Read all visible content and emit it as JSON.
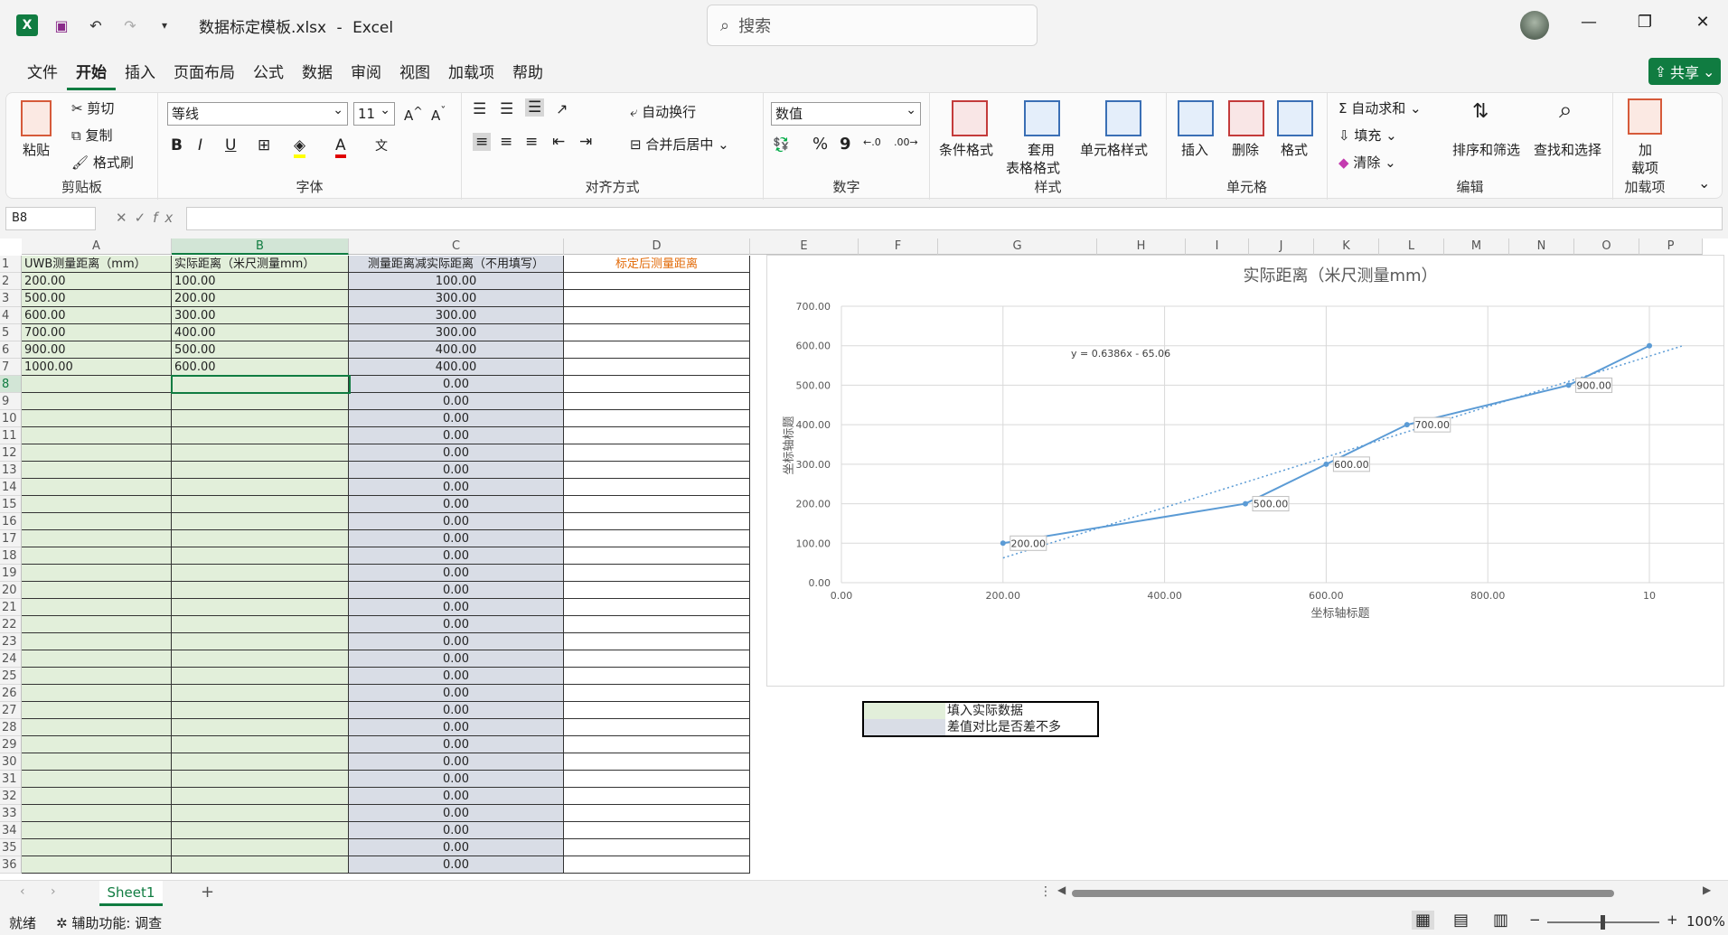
{
  "titlebar": {
    "filename": "数据标定模板.xlsx",
    "sep": "-",
    "app": "Excel",
    "search_placeholder": "搜索"
  },
  "menu": {
    "tabs": [
      "文件",
      "开始",
      "插入",
      "页面布局",
      "公式",
      "数据",
      "审阅",
      "视图",
      "加载项",
      "帮助"
    ],
    "active": "开始",
    "share": "共享"
  },
  "ribbon": {
    "clipboard": {
      "paste": "粘贴",
      "cut": "剪切",
      "copy": "复制",
      "format_painter": "格式刷",
      "label": "剪贴板"
    },
    "font": {
      "name": "等线",
      "size": "11",
      "label": "字体",
      "bold": "B",
      "italic": "I",
      "underline": "U"
    },
    "align": {
      "wrap": "自动换行",
      "merge": "合并后居中",
      "label": "对齐方式"
    },
    "number": {
      "format": "数值",
      "label": "数字",
      "percent": "%",
      "comma": "9"
    },
    "styles": {
      "cond": "条件格式",
      "table1": "套用",
      "table2": "表格格式",
      "cell": "单元格样式",
      "label": "样式"
    },
    "cells": {
      "insert": "插入",
      "delete": "删除",
      "format": "格式",
      "label": "单元格"
    },
    "edit": {
      "autosum": "自动求和",
      "fill": "填充",
      "clear": "清除",
      "sort": "排序和筛选",
      "find": "查找和选择",
      "label": "编辑"
    },
    "addins": {
      "l1": "加",
      "l2": "载项",
      "label": "加载项"
    }
  },
  "formula_bar": {
    "name_box": "B8",
    "fx": "fx",
    "value": ""
  },
  "columns": [
    "A",
    "B",
    "C",
    "D",
    "E",
    "F",
    "G",
    "H",
    "I",
    "J",
    "K",
    "L",
    "M",
    "N",
    "O",
    "P"
  ],
  "selected_column": "B",
  "selected_row": 8,
  "headers": {
    "A": "UWB测量距离（mm）",
    "B": "实际距离（米尺测量mm）",
    "C": "测量距离减实际距离（不用填写）",
    "D": "标定后测量距离"
  },
  "rows": [
    {
      "a": "200.00",
      "b": "100.00",
      "c": "100.00"
    },
    {
      "a": "500.00",
      "b": "200.00",
      "c": "300.00"
    },
    {
      "a": "600.00",
      "b": "300.00",
      "c": "300.00"
    },
    {
      "a": "700.00",
      "b": "400.00",
      "c": "300.00"
    },
    {
      "a": "900.00",
      "b": "500.00",
      "c": "400.00"
    },
    {
      "a": "1000.00",
      "b": "600.00",
      "c": "400.00"
    }
  ],
  "empty_c": "0.00",
  "legend": {
    "fill": "填入实际数据",
    "diff": "差值对比是否差不多",
    "fill_color": "#e2efda",
    "diff_color": "#d9dde6"
  },
  "chart_data": {
    "type": "scatter",
    "title": "实际距离（米尺测量mm）",
    "xlabel": "坐标轴标题",
    "ylabel": "坐标轴标题",
    "trendline": "y = 0.6386x - 65.06",
    "x": [
      200,
      500,
      600,
      700,
      900,
      1000
    ],
    "y": [
      100,
      200,
      300,
      400,
      500,
      600
    ],
    "point_labels": [
      "200.00",
      "500.00",
      "600.00",
      "700.00",
      "900.00"
    ],
    "xticks": [
      "0.00",
      "200.00",
      "400.00",
      "600.00",
      "800.00",
      "10"
    ],
    "yticks": [
      "0.00",
      "100.00",
      "200.00",
      "300.00",
      "400.00",
      "500.00",
      "600.00",
      "700.00"
    ],
    "xlim": [
      0,
      1000
    ],
    "ylim": [
      0,
      700
    ],
    "grid": true,
    "color": "#5b9bd5"
  },
  "sheets": [
    "Sheet1"
  ],
  "status": {
    "ready": "就绪",
    "accessibility": "辅助功能: 调查",
    "zoom": "100%"
  }
}
